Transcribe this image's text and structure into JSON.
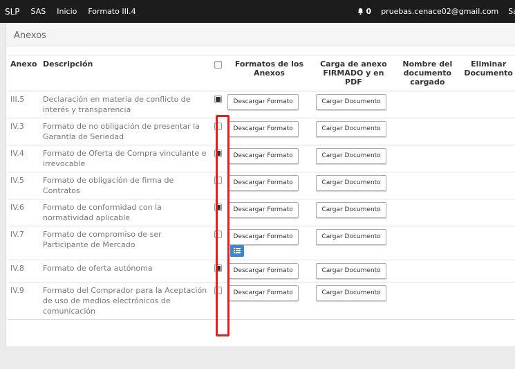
{
  "topbar": {
    "brand": "SLP",
    "nav": [
      "SAS",
      "Inicio",
      "Formato III.4"
    ],
    "notification_count": "0",
    "user_email": "pruebas.cenace02@gmail.com",
    "truncated_right": "Sa"
  },
  "panel": {
    "title": "Anexos"
  },
  "table": {
    "headers": {
      "anexo": "Anexo",
      "descripcion": "Descripción",
      "formatos": "Formatos de los Anexos",
      "carga": "Carga de anexo FIRMADO y en PDF",
      "nombre": "Nombre del documento cargado",
      "eliminar": "Eliminar Documento"
    },
    "download_label": "Descargar Formato",
    "upload_label": "Cargar Documento",
    "rows": [
      {
        "anexo": "III.5",
        "descripcion": "Declaración en materia de conflicto de interés y transparencia",
        "checked": true,
        "extra_button": false
      },
      {
        "anexo": "IV.3",
        "descripcion": "Formato de no obligación de presentar la Garantía de Seriedad",
        "checked": false,
        "extra_button": false
      },
      {
        "anexo": "IV.4",
        "descripcion": "Formato de Oferta de Compra vinculante e irrevocable",
        "checked": true,
        "extra_button": false
      },
      {
        "anexo": "IV.5",
        "descripcion": "Formato de obligación de firma de Contratos",
        "checked": false,
        "extra_button": false
      },
      {
        "anexo": "IV.6",
        "descripcion": "Formato de conformidad con la normatividad aplicable",
        "checked": true,
        "extra_button": false
      },
      {
        "anexo": "IV.7",
        "descripcion": "Formato de compromiso de ser Participante de Mercado",
        "checked": false,
        "extra_button": true
      },
      {
        "anexo": "IV.8",
        "descripcion": "Formato de oferta autónoma",
        "checked": true,
        "extra_button": false
      },
      {
        "anexo": "IV.9",
        "descripcion": "Formato del Comprador para la Aceptación de uso de medios electrónicos de comunicación",
        "checked": false,
        "extra_button": false
      }
    ]
  },
  "colors": {
    "topbar": "#1c1c1c",
    "highlight": "#e02020",
    "accent_button": "#3a87d4"
  },
  "icons": {
    "bell": "bell-icon",
    "list": "list-icon"
  }
}
